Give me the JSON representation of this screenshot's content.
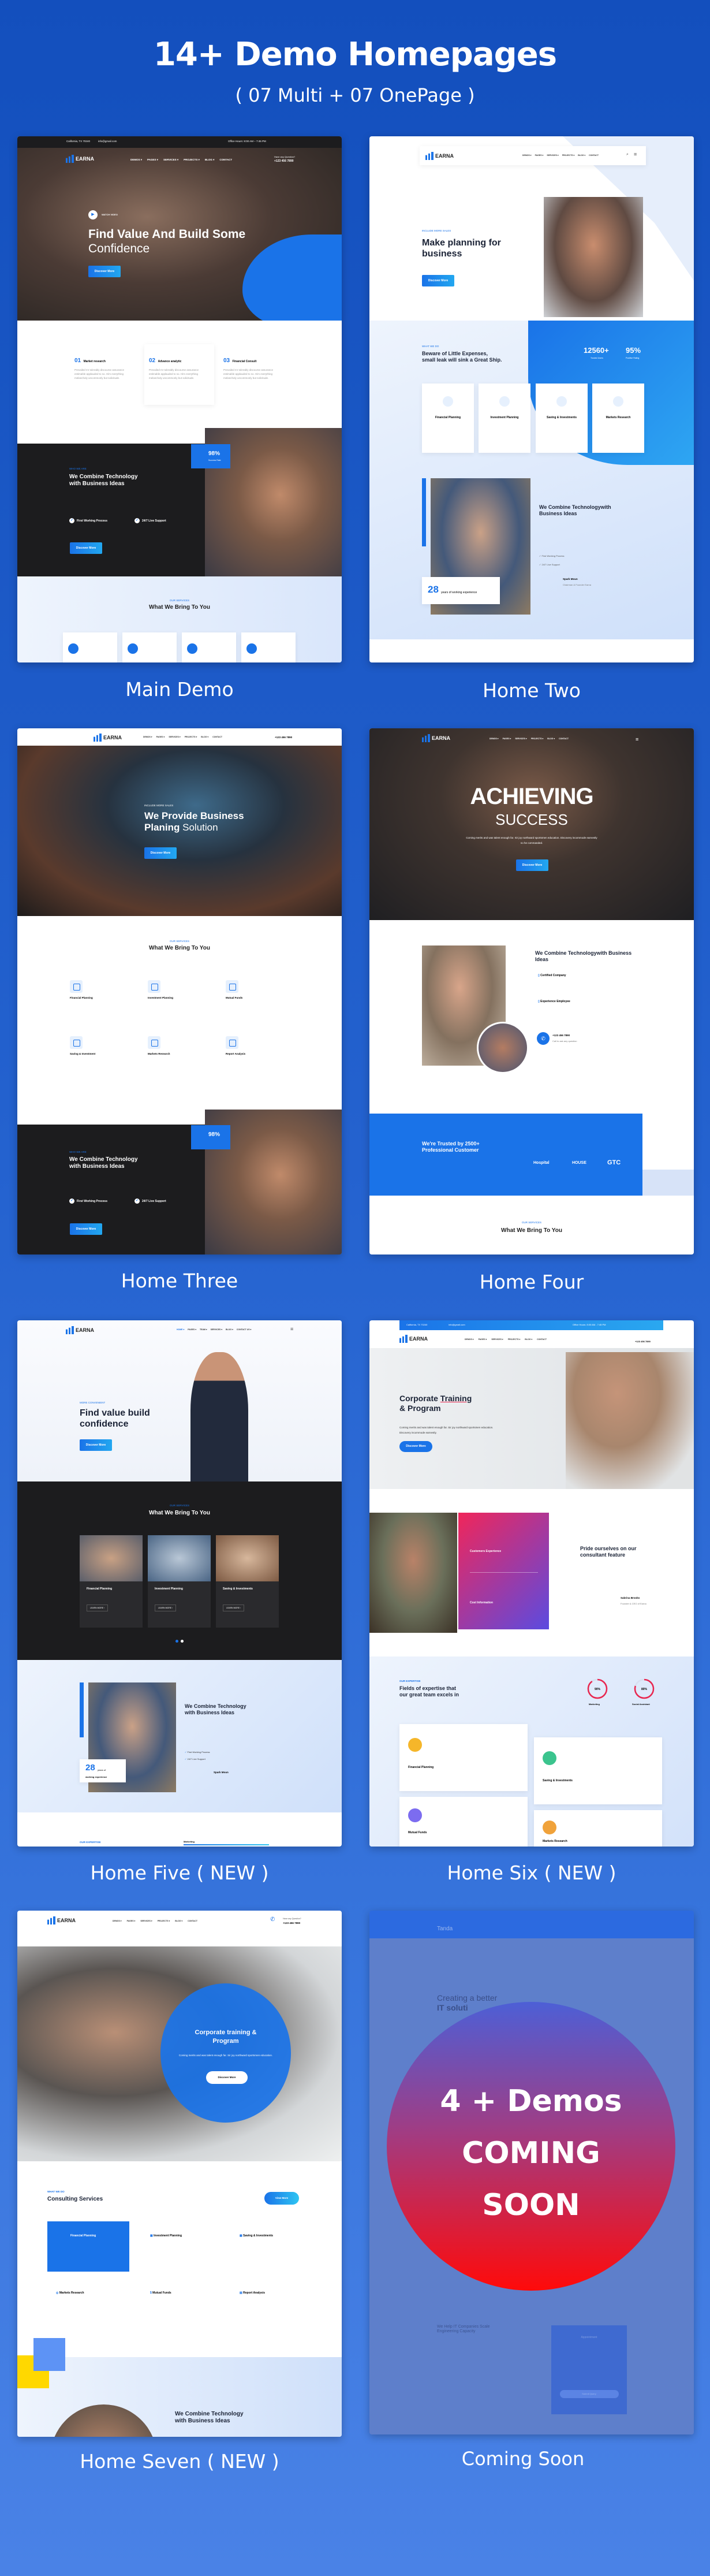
{
  "header": {
    "title": "14+ Demo Homepages",
    "subtitle": "( 07 Multi + 07 OnePage  )"
  },
  "colors": {
    "background_top": "#134fbd",
    "background_bottom": "#4a82e6",
    "accent": "#1a73e8",
    "dark": "#1c1c1e",
    "coming_soon_top": "#4d5fd6",
    "coming_soon_bottom": "#ff0a0a"
  },
  "demos": [
    {
      "label": "Main Demo",
      "topbar": {
        "location": "California, TX 70240",
        "email": "info@gmail.com",
        "hours": "Office Hours: 8:00 AM – 7:45 PM"
      },
      "nav": {
        "logo": "EARNA",
        "menu": [
          "DEMOS ▾",
          "PAGES ▾",
          "SERVICES ▾",
          "PROJECTS ▾",
          "BLOG ▾",
          "CONTACT"
        ],
        "phone_label": "Have any Question?",
        "phone": "+123 456 7890"
      },
      "hero": {
        "watch": "WATCH VIDEO",
        "title_1": "Find Value And Build Some",
        "title_2": "Confidence",
        "button": "Discover More"
      },
      "features": [
        {
          "num": "01",
          "title": "Market research"
        },
        {
          "num": "02",
          "title": "Advance analytic"
        },
        {
          "num": "03",
          "title": "Financial Consult"
        }
      ],
      "feature_desc": "Prevailed mr tolerably discourse assurance estimable applauded to so. Him everything melancholy uncommonly but solicitude.",
      "about": {
        "tag": "WHO WE ARE",
        "title_1": "We Combine Technology",
        "title_2": "with Business Ideas",
        "stat": "98%",
        "stat_label": "Success Rate",
        "checks": [
          "First Working Process",
          "24/7 Live Support"
        ],
        "button": "Discover More"
      },
      "services": {
        "tag": "OUR SERVICES",
        "title": "What We Bring To You"
      }
    },
    {
      "label": "Home Two",
      "nav": {
        "logo": "EARNA",
        "menu": [
          "DEMOS ▾",
          "PAGES ▾",
          "SERVICES ▾",
          "PROJECTS ▾",
          "BLOG ▾",
          "CONTACT"
        ]
      },
      "hero": {
        "tag": "INCLUDE MORE SALES",
        "title_1": "Make planning for",
        "title_2": "business",
        "button": "Discover More"
      },
      "whatwedo": {
        "tag": "WHAT WE DO",
        "title_1": "Beware of Little Expenses,",
        "title_2": "small leak will sink a Great Ship.",
        "stats": [
          {
            "value": "12560+",
            "label": "Trusted Users"
          },
          {
            "value": "95%",
            "label": "Positive Rating"
          }
        ],
        "cards": [
          "Financial Planning",
          "Investment Planning",
          "Saving & Investments",
          "Markets Research"
        ]
      },
      "about": {
        "years": "28",
        "years_label": "years of working experience",
        "title_1": "We Combine Technologywith",
        "title_2": "Business Ideas",
        "checks": [
          "First Working Process",
          "24/7 Live Support"
        ],
        "sig_name": "Spark Moun",
        "sig_role": "Chairman & Founder Earna"
      }
    },
    {
      "label": "Home Three",
      "nav": {
        "logo": "EARNA",
        "menu": [
          "DEMOS ▾",
          "PAGES ▾",
          "SERVICES ▾",
          "PROJECTS ▾",
          "BLOG ▾",
          "CONTACT"
        ],
        "phone": "+123 456 7890"
      },
      "hero": {
        "tag": "INCLUDE MORE SALES",
        "title_1": "We Provide Business",
        "title_2a": "Planing",
        "title_2b": "Solution",
        "button": "Discover More"
      },
      "services": {
        "tag": "OUR SERVICES",
        "title": "What We Bring To You",
        "items": [
          "Financial Planning",
          "Investment Planning",
          "Mutual Funds",
          "Saving & Investment",
          "Markets Research",
          "Report Analysis"
        ]
      },
      "about": {
        "tag": "WHO WE ARE",
        "title_1": "We Combine Technology",
        "title_2": "with Business Ideas",
        "stat": "98%",
        "checks": [
          "First Working Process",
          "24/7 Live Support"
        ],
        "button": "Discover More"
      }
    },
    {
      "label": "Home Four",
      "nav": {
        "logo": "EARNA",
        "menu": [
          "DEMOS ▾",
          "PAGES ▾",
          "SERVICES ▾",
          "PROJECTS ▾",
          "BLOG ▾",
          "CONTACT"
        ]
      },
      "hero": {
        "title_1": "ACHIEVING",
        "title_2": "SUCCESS",
        "text": "Coming merits and was talent enough far. Sir joy northward sportsmen education. Discovery incommode earnestly no he commanded.",
        "button": "Discover More"
      },
      "about": {
        "title_1": "We Combine Technologywith Business",
        "title_2": "Ideas",
        "items": [
          "Certified Company",
          "Experience Employee"
        ],
        "phone": "+123 456 7890",
        "phone_sub": "Call to ask any question"
      },
      "trusted": {
        "title_1": "We're Trusted by 2500+",
        "title_2": "Professional Customer",
        "logos": [
          "Hospital",
          "HOUSE",
          "GTC"
        ]
      },
      "services": {
        "tag": "OUR SERVICES",
        "title": "What We Bring To You"
      }
    },
    {
      "label": "Home Five ( NEW )",
      "nav": {
        "logo": "EARNA",
        "menu": [
          "HOME ▾",
          "PAGES ▾",
          "TEAM ▾",
          "SERVICES ▾",
          "BLOG ▾",
          "CONTACT US ▾"
        ]
      },
      "hero": {
        "tag": "MORE CONVENIENT",
        "title_1": "Find value build",
        "title_2": "confidence",
        "button": "Discover More"
      },
      "services": {
        "tag": "OUR SERVICES",
        "title": "What We Bring To You",
        "cards": [
          "Financial Planning",
          "Investment Planning",
          "Saving & Investments"
        ],
        "learn": "LEARN MORE ›"
      },
      "about": {
        "years": "28",
        "years_label_1": "years of",
        "years_label_2": "working experience",
        "title_1": "We Combine Technology",
        "title_2": "with Business Ideas",
        "checks": [
          "First Working Process",
          "24/7 Live Support"
        ],
        "sig_name": "Spark Moun"
      },
      "expertise": {
        "tag": "OUR EXPERTISE",
        "bar_label": "Marketing"
      }
    },
    {
      "label": "Home Six ( NEW )",
      "topbar": {
        "location": "California, TX 70240",
        "email": "info@gmail.com",
        "hours": "Office Hours: 8:00 AM - 7:45 PM"
      },
      "nav": {
        "logo": "EARNA",
        "menu": [
          "DEMOS ▾",
          "PAGES ▾",
          "SERVICES ▾",
          "PROJECTS ▾",
          "BLOG ▾",
          "CONTACT"
        ],
        "phone": "+123 456 7890"
      },
      "hero": {
        "title_1a": "Corporate",
        "title_1b": "Training",
        "title_2": "& Program",
        "text": "Coming merits and was talent enough far. Sir joy northward sportsmen education. Discovery incommode earnestly.",
        "button": "Discover More"
      },
      "features": [
        "Customers Experience",
        "Cost Information"
      ],
      "pride": {
        "title_1": "Pride ourselves on our",
        "title_2": "consultant feature",
        "sig_name": "Sabrina Brooks",
        "sig_role": "Founder & CEO of Earna"
      },
      "expertise": {
        "tag": "OUR EXPERTISE",
        "title_1": "Fields of expertise that",
        "title_2": "our great team excels in",
        "circles": [
          {
            "value": "90%",
            "label": "Marketing",
            "level": 0.9
          },
          {
            "value": "80%",
            "label": "Social Assistant",
            "level": 0.8
          }
        ],
        "cards": [
          "Financial Planning",
          "Saving & Investments",
          "Mutual Funds",
          "Markets Research"
        ]
      }
    },
    {
      "label": "Home Seven ( NEW )",
      "nav": {
        "logo": "EARNA",
        "menu": [
          "DEMOS ▾",
          "PAGES ▾",
          "SERVICES ▾",
          "PROJECTS ▾",
          "BLOG ▾",
          "CONTACT"
        ],
        "phone_label": "Have any Question?",
        "phone": "+123 456 7890"
      },
      "hero": {
        "title_1": "Corporate training &",
        "title_2": "Program",
        "text": "Coming merits and was talent enough far. Sir joy northward sportsmen education.",
        "button": "Discover More"
      },
      "services": {
        "tag": "WHAT WE DO",
        "title": "Consulting Services",
        "view": "View More",
        "items": [
          "Financial Planning",
          "Investment Planning",
          "Saving & Investments",
          "Markets Research",
          "Mutual Funds",
          "Report Analysis"
        ]
      },
      "about": {
        "title_1": "We Combine Technology",
        "title_2": "with Business Ideas"
      }
    },
    {
      "label": "Coming Soon",
      "faded": {
        "logo": "Tanda",
        "title_1": "Creating a better",
        "title_2": "IT soluti",
        "section_1": "We Help IT Companies Scale",
        "section_2": "Engineering Capacity",
        "form_title": "Appointment",
        "form_button": "Submit Query"
      },
      "badge": {
        "line_1": "4 + Demos",
        "line_2": "COMING",
        "line_3": "SOON"
      }
    }
  ]
}
